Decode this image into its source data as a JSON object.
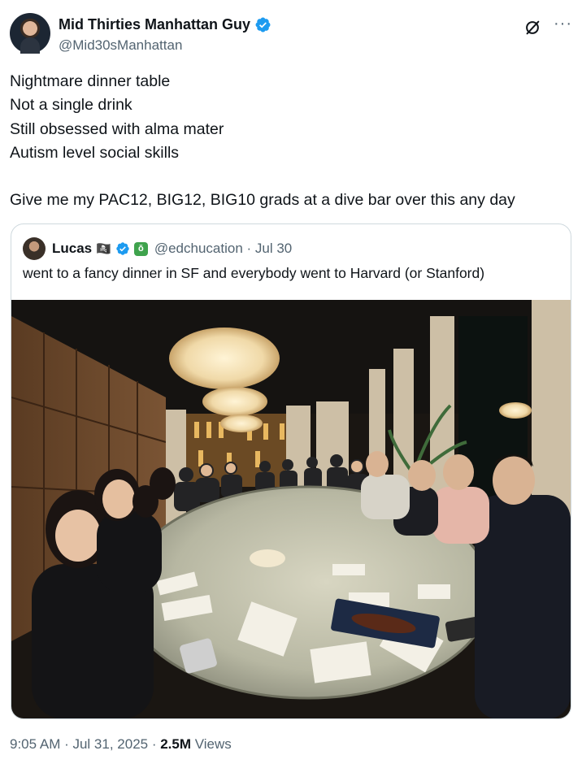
{
  "author": {
    "display_name": "Mid Thirties Manhattan Guy",
    "handle": "@Mid30sManhattan",
    "verified": true,
    "avatar_icon": "profile-photo"
  },
  "header_actions": {
    "grok_icon": "grok-icon",
    "more_icon": "more-icon",
    "more_label": "···"
  },
  "tweet": {
    "lines": [
      "Nightmare dinner table",
      "Not a single drink",
      "Still obsessed with alma mater",
      "Autism level social skills",
      "",
      "Give me my PAC12, BIG12, BIG10 grads at a dive bar over this any day"
    ]
  },
  "quote": {
    "display_name": "Lucas",
    "name_emoji": "🏴‍☠️",
    "affiliation_badge": "ǒ",
    "handle_date": "@edchucation · Jul 30",
    "text": "went to a fancy dinner in SF and everybody went to Harvard (or Stanford)",
    "photo_icon": "dinner-table-photo"
  },
  "meta": {
    "time": "9:05 AM · Jul 31, 2025 · ",
    "views_count": "2.5M",
    "views_label": " Views"
  },
  "colors": {
    "verified_blue": "#1d9bf0",
    "text": "#0f1419",
    "secondary": "#536471",
    "border": "#cfd9de"
  }
}
